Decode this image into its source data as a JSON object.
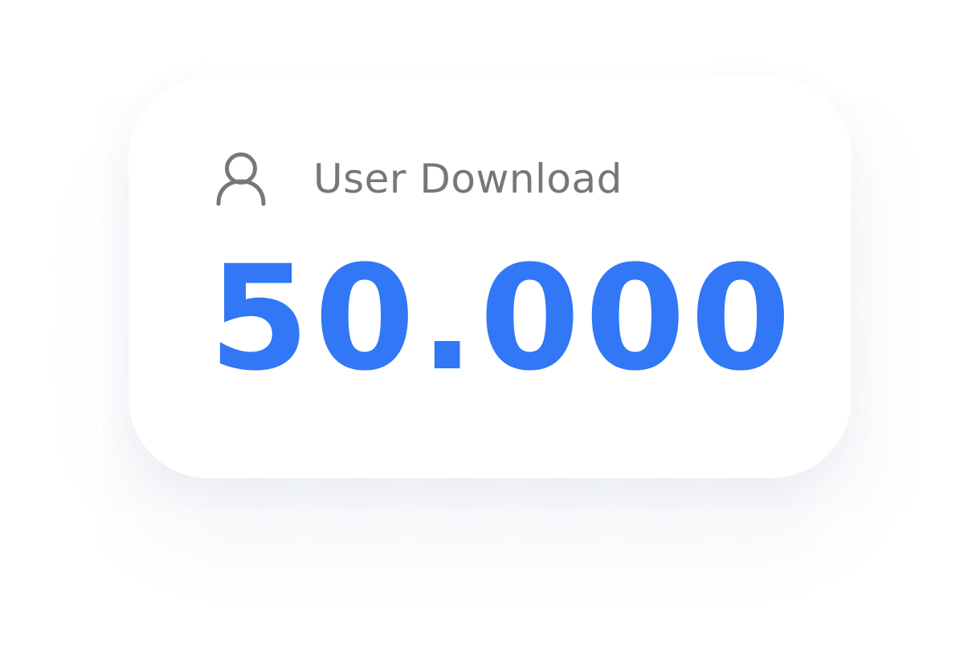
{
  "card": {
    "title": "User Download",
    "value": "50.000",
    "icon": "user-icon"
  },
  "colors": {
    "value": "#3177f6",
    "label": "#777777",
    "icon": "#777777"
  }
}
